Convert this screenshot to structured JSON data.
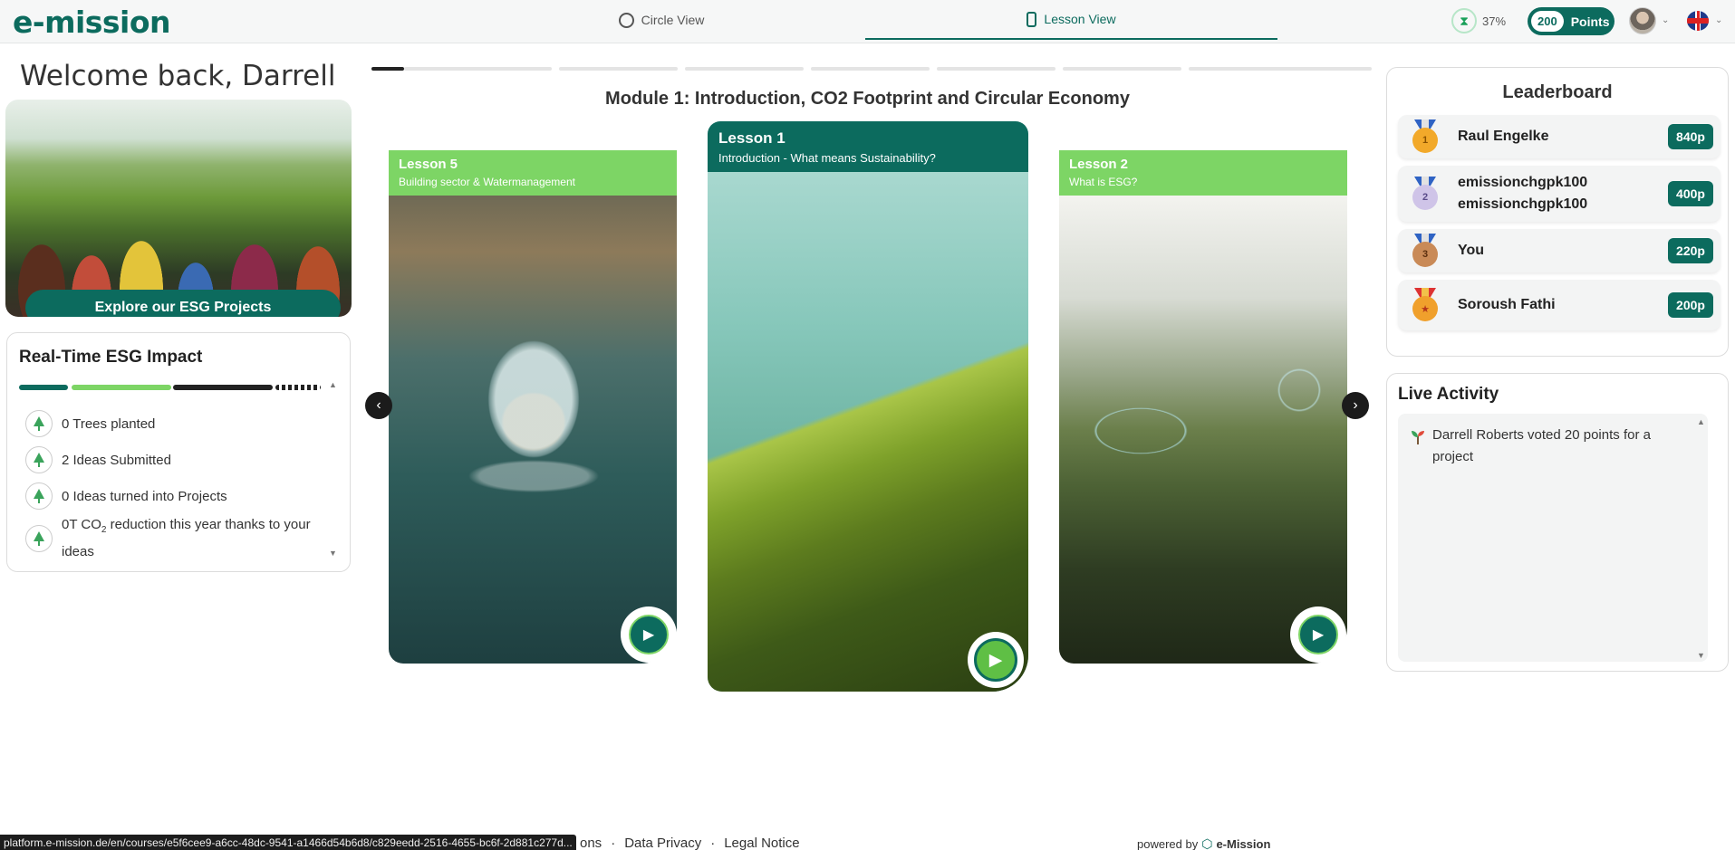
{
  "header": {
    "logo": "e-mission",
    "tabs": [
      {
        "label": "Circle View",
        "icon": "circle-icon"
      },
      {
        "label": "Lesson View",
        "icon": "phone-icon",
        "active": true
      }
    ],
    "progress_percent": "37%",
    "points_value": "200",
    "points_label": "Points",
    "language": "flag-uk-icon"
  },
  "welcome": "Welcome back, Darrell",
  "esg_banner": {
    "button_label": "Explore our ESG Projects"
  },
  "impact": {
    "title": "Real-Time ESG Impact",
    "items": [
      {
        "text": "0 Trees planted"
      },
      {
        "text": "2 Ideas Submitted"
      },
      {
        "text": "0 Ideas turned into Projects"
      },
      {
        "text_pre": "0T CO",
        "text_sub": "2",
        "text_post": " reduction this year thanks to your ideas"
      }
    ]
  },
  "module": {
    "title": "Module 1: Introduction, CO2 Footprint and Circular Economy",
    "segments_total": 8,
    "segment_active": 1
  },
  "lessons": [
    {
      "title": "Lesson 5",
      "subtitle": "Building sector & Watermanagement",
      "position": "left"
    },
    {
      "title": "Lesson 1",
      "subtitle": "Introduction - What means Sustainability?",
      "position": "center"
    },
    {
      "title": "Lesson 2",
      "subtitle": "What is ESG?",
      "position": "right"
    }
  ],
  "leaderboard": {
    "title": "Leaderboard",
    "rows": [
      {
        "rank": "1",
        "name": "Raul Engelke",
        "points": "840p",
        "medal_color": "#f2a92a"
      },
      {
        "rank": "2",
        "name_line1": "emissionchgpk100",
        "name_line2": "emissionchgpk100",
        "points": "400p",
        "medal_color": "#cfc4e8"
      },
      {
        "rank": "3",
        "name": "You",
        "points": "220p",
        "medal_color": "#c98a57"
      },
      {
        "rank": "★",
        "name": "Soroush Fathi",
        "points": "200p",
        "medal_color": "#f0a02c"
      }
    ]
  },
  "activity": {
    "title": "Live Activity",
    "items": [
      {
        "text": "Darrell Roberts voted 20 points for a project"
      }
    ]
  },
  "footer": {
    "links": [
      "ons",
      "·",
      "Data Privacy",
      "·",
      "Legal Notice"
    ],
    "powered_by": "powered by",
    "powered_brand": "e-Mission",
    "status_url": "platform.e-mission.de/en/courses/e5f6cee9-a6cc-48dc-9541-a1466d54b6d8/c829eedd-2516-4655-bc6f-2d881c277d..."
  },
  "colors": {
    "brand": "#0c6b5e",
    "accent": "#7dd565"
  }
}
